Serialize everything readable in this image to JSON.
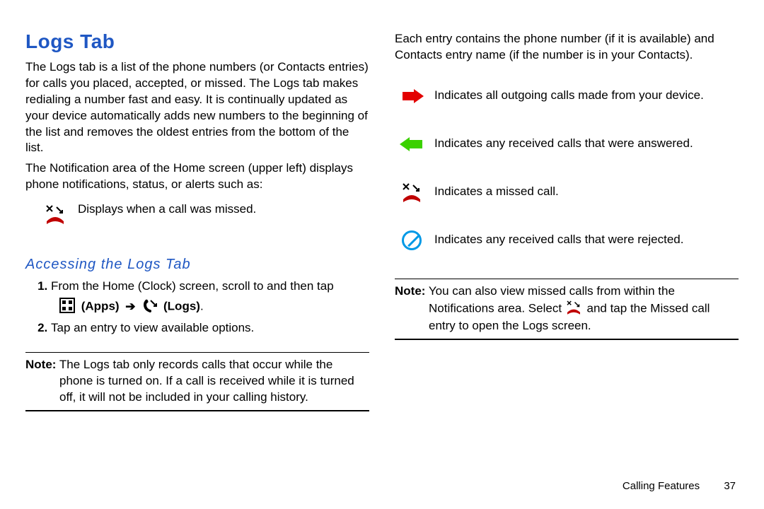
{
  "left": {
    "heading": "Logs Tab",
    "p1": "The Logs tab is a list of the phone numbers (or Contacts entries) for calls you placed, accepted, or missed. The Logs tab makes redialing a number fast and easy. It is continually updated as your device automatically adds new numbers to the beginning of the list and removes the oldest entries from the bottom of the list.",
    "p2": "The Notification area of the Home screen (upper left) displays phone notifications, status, or alerts such as:",
    "missed_desc": "Displays when a call was missed.",
    "subheading": "Accessing the Logs Tab",
    "step1_a": "From the Home (Clock) screen, scroll to and then tap",
    "apps_label": "(Apps)",
    "arrow": "➔",
    "logs_label": "(Logs)",
    "period": ".",
    "step2": "Tap an entry to view available options.",
    "note_lead": "Note:",
    "note_body_first": " The Logs tab only records calls that occur while the",
    "note_body_rest": "phone is turned on. If a call is received while it is turned off, it will not be included in your calling history."
  },
  "right": {
    "intro": "Each entry contains the phone number (if it is available) and Contacts entry name (if the number is in your Contacts).",
    "outgoing": "Indicates all outgoing calls made from your device.",
    "received": "Indicates any received calls that were answered.",
    "missed": "Indicates a missed call.",
    "rejected": "Indicates any received calls that were rejected.",
    "note_lead": "Note:",
    "note_body_first": " You can also view missed calls from within the",
    "note_body_mid_a": "Notifications area. Select ",
    "note_body_mid_b": " and tap the Missed call",
    "note_body_last": "entry to open the Logs screen."
  },
  "footer": {
    "section": "Calling Features",
    "page": "37"
  }
}
